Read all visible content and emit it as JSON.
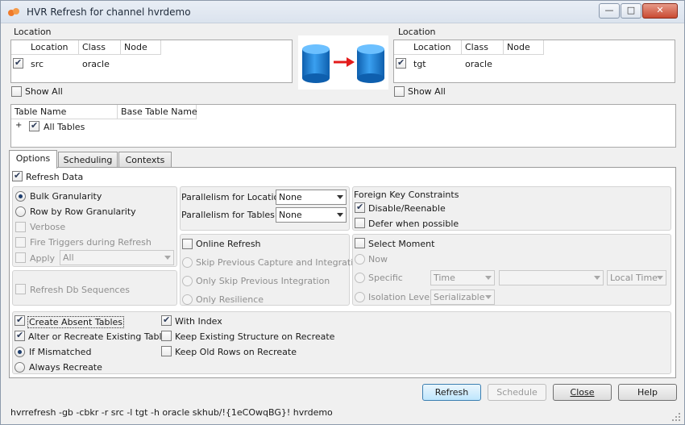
{
  "window": {
    "title": "HVR Refresh for channel hvrdemo"
  },
  "source": {
    "group_label": "Location",
    "columns": [
      "Location",
      "Class",
      "Node"
    ],
    "row": {
      "checked": true,
      "location": "src",
      "class": "oracle",
      "node": ""
    },
    "show_all_label": "Show All"
  },
  "target": {
    "group_label": "Location",
    "columns": [
      "Location",
      "Class",
      "Node"
    ],
    "row": {
      "checked": true,
      "location": "tgt",
      "class": "oracle",
      "node": ""
    },
    "show_all_label": "Show All"
  },
  "tables": {
    "columns": [
      "Table Name",
      "Base Table Name"
    ],
    "root": {
      "expander": "+",
      "checked": true,
      "label": "All Tables"
    }
  },
  "tabs": [
    {
      "label": "Options",
      "active": true
    },
    {
      "label": "Scheduling",
      "active": false
    },
    {
      "label": "Contexts",
      "active": false
    }
  ],
  "options": {
    "refresh_data": "Refresh Data",
    "bulk_granularity": "Bulk Granularity",
    "row_by_row": "Row by Row Granularity",
    "verbose": "Verbose",
    "fire_triggers": "Fire Triggers during Refresh",
    "apply": "Apply",
    "apply_value": "All",
    "refresh_db_sequences": "Refresh Db Sequences",
    "parallelism_locations": "Parallelism for Locations",
    "parallelism_locations_value": "None",
    "parallelism_tables": "Parallelism for Tables",
    "parallelism_tables_value": "None",
    "online_refresh": "Online Refresh",
    "skip_previous": "Skip Previous Capture and Integration",
    "only_skip": "Only Skip Previous Integration",
    "only_resilience": "Only Resilience",
    "fk_title": "Foreign Key Constraints",
    "disable_reenable": "Disable/Reenable",
    "defer_when_possible": "Defer when possible",
    "select_moment": "Select Moment",
    "now": "Now",
    "specific": "Specific",
    "specific_type": "Time",
    "specific_value": "",
    "specific_zone": "Local Time",
    "isolation_level": "Isolation Level",
    "isolation_value": "Serializable",
    "create_absent": "Create Absent Tables",
    "with_index": "With Index",
    "alter_recreate": "Alter or Recreate Existing Tables",
    "keep_structure": "Keep Existing Structure on Recreate",
    "if_mismatched": "If Mismatched",
    "keep_old_rows": "Keep Old Rows on Recreate",
    "always_recreate": "Always Recreate"
  },
  "buttons": {
    "refresh": "Refresh",
    "schedule": "Schedule",
    "close": "Close",
    "help": "Help"
  },
  "command_line": "hvrrefresh -gb -cbkr -r src -l tgt -h oracle skhub/!{1eCOwqBG}! hvrdemo",
  "colors": {
    "accent_red": "#e31b1b",
    "db_blue": "#1f7fd0"
  }
}
